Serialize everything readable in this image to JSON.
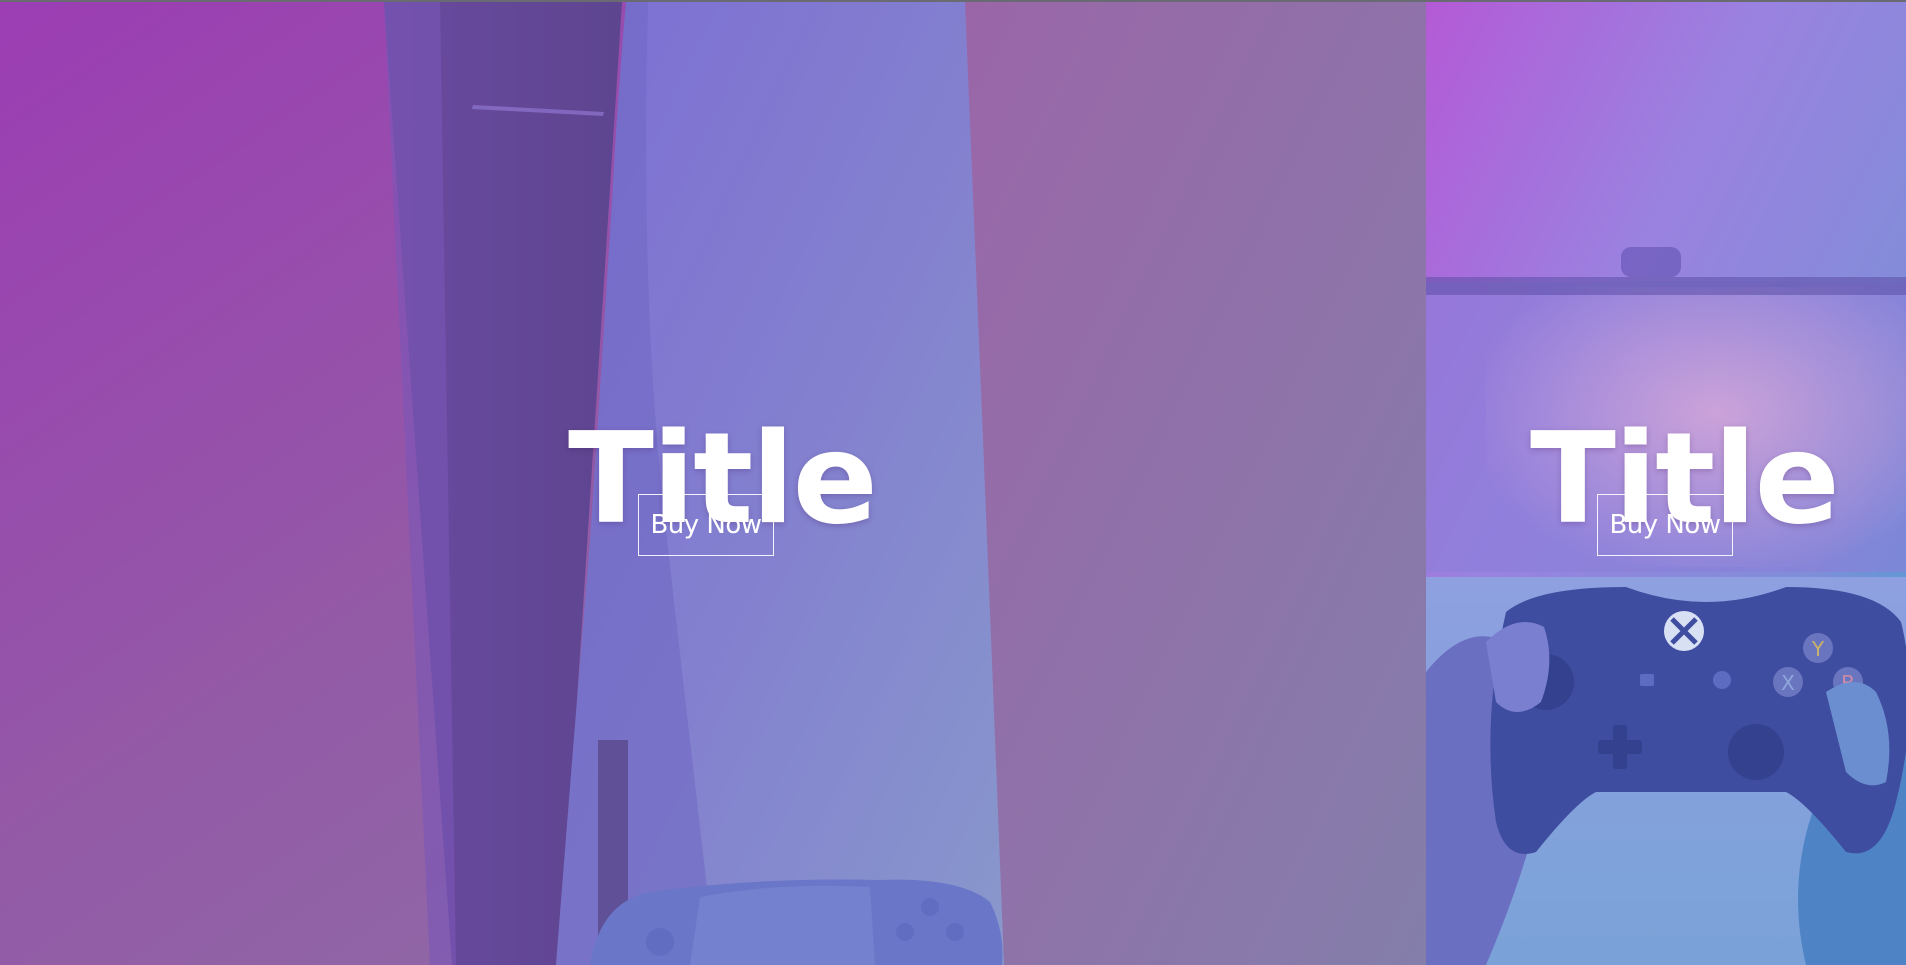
{
  "slides": [
    {
      "title": "Title",
      "cta_label": "Buy Now",
      "image": "playstation-console-with-controller"
    },
    {
      "title": "Title",
      "cta_label": "Buy Now",
      "image": "hands-holding-xbox-controller"
    }
  ],
  "controller_buttons": {
    "y": "Y",
    "x": "X",
    "b": "B"
  },
  "colors": {
    "overlay_purple": "#9b3bb3",
    "overlay_cyan": "#22a3c9",
    "text": "#ffffff"
  }
}
